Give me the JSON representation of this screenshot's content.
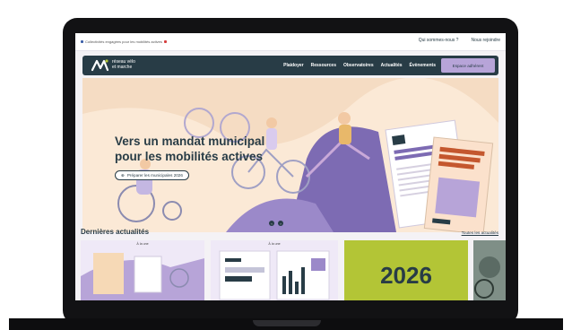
{
  "topbar": {
    "left_text": "Collectivités engagées pour les mobilités actives",
    "links": [
      "Qui sommes-nous ?",
      "Nous rejoindre"
    ]
  },
  "nav": {
    "logo_line1": "réseau vélo",
    "logo_line2": "et marche",
    "menu": [
      "Plaidoyer",
      "Ressources",
      "Observatoires",
      "Actualités",
      "Évènements"
    ],
    "cta": "Espace adhérent"
  },
  "hero": {
    "title": "Vers un mandat municipal pour les mobilités actives",
    "button": "Préparer les municipales 2026",
    "prev": "‹",
    "next": "›"
  },
  "news": {
    "heading": "Dernières actualités",
    "all_link": "Toutes les actualités",
    "cards": [
      {
        "label": "À la une"
      },
      {
        "label": "À la une"
      },
      {
        "label": "2026"
      }
    ]
  },
  "colors": {
    "primary": "#283c46",
    "lavender": "#b7a4d8",
    "hero_bg": "#fbe9d6",
    "lime": "#b3c536"
  }
}
